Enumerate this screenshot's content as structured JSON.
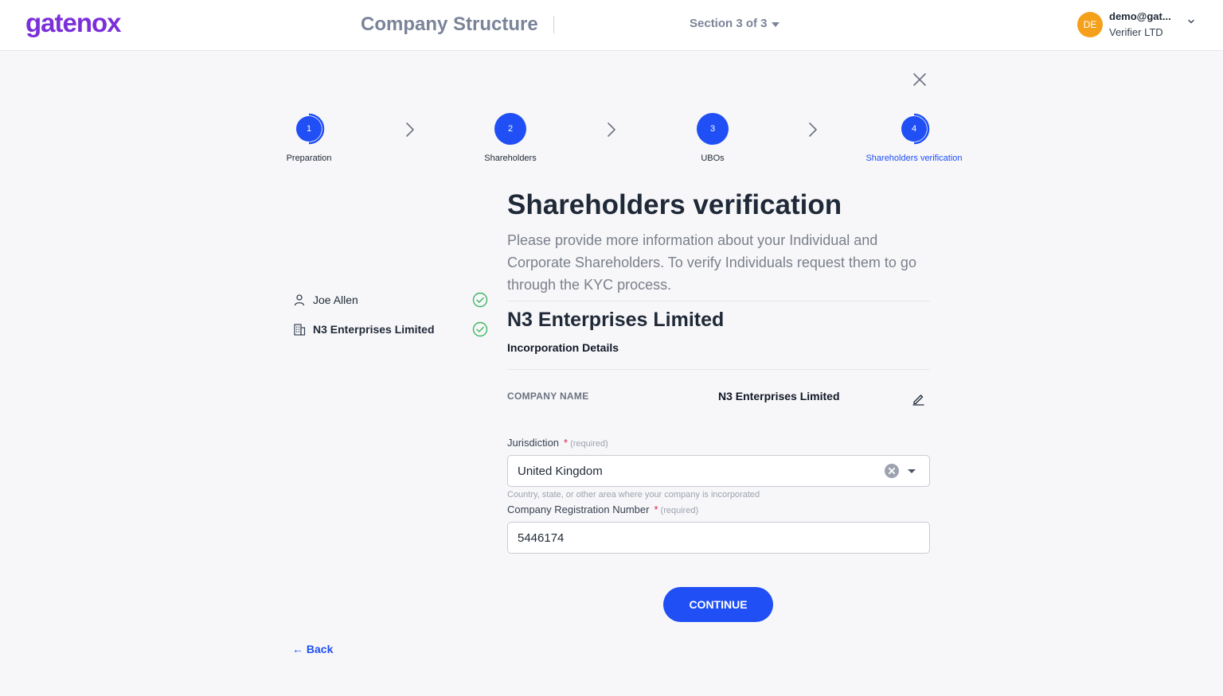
{
  "header": {
    "logo_text": "gatenox",
    "title": "Company Structure",
    "section_label": "Section 3 of 3",
    "user": {
      "initials": "DE",
      "email": "demo@gat...",
      "org": "Verifier LTD"
    }
  },
  "steps": [
    {
      "number": "1",
      "label": "Preparation"
    },
    {
      "number": "2",
      "label": "Shareholders"
    },
    {
      "number": "3",
      "label": "UBOs"
    },
    {
      "number": "4",
      "label": "Shareholders verification"
    }
  ],
  "sidebar": {
    "items": [
      {
        "name": "Joe Allen",
        "icon": "person-icon",
        "status": "complete"
      },
      {
        "name": "N3 Enterprises Limited",
        "icon": "building-icon",
        "status": "complete"
      }
    ]
  },
  "main": {
    "title": "Shareholders verification",
    "description": "Please provide more information about your Individual and Corporate Shareholders. To verify Individuals request them to go through the KYC process.",
    "company_heading": "N3 Enterprises Limited",
    "subheading": "Incorporation Details",
    "company_name_label": "COMPANY NAME",
    "company_name_value": "N3 Enterprises Limited",
    "jurisdiction": {
      "label": "Jurisdiction",
      "required_star": "*",
      "required_text": "(required)",
      "value": "United Kingdom",
      "helper": "Country, state, or other area where your company is incorporated"
    },
    "registration": {
      "label": "Company Registration Number",
      "required_star": "*",
      "required_text": "(required)",
      "value": "5446174"
    },
    "continue_label": "CONTINUE",
    "back_label": "← Back"
  },
  "colors": {
    "brand_purple": "#7b2fd9",
    "primary_blue": "#1f4ff5",
    "success_green": "#3fb561",
    "avatar_orange": "#f5a01a"
  }
}
